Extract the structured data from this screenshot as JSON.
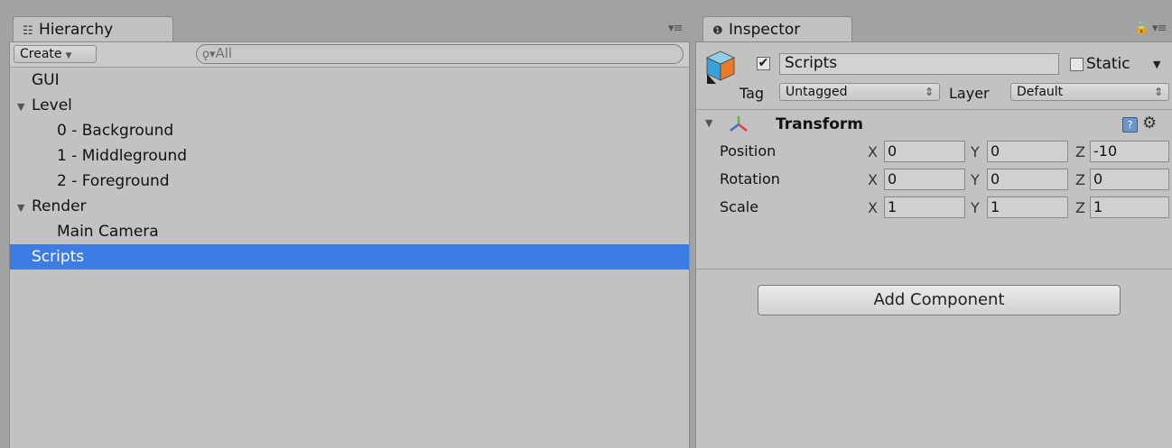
{
  "hierarchy": {
    "tab_label": "Hierarchy",
    "create_label": "Create",
    "search_placeholder": "All",
    "items": [
      {
        "label": "GUI",
        "indent": 0,
        "arrow": "",
        "selected": false
      },
      {
        "label": "Level",
        "indent": 0,
        "arrow": "▼",
        "selected": false
      },
      {
        "label": "0 - Background",
        "indent": 1,
        "arrow": "",
        "selected": false
      },
      {
        "label": "1 - Middleground",
        "indent": 1,
        "arrow": "",
        "selected": false
      },
      {
        "label": "2 - Foreground",
        "indent": 1,
        "arrow": "",
        "selected": false
      },
      {
        "label": "Render",
        "indent": 0,
        "arrow": "▼",
        "selected": false
      },
      {
        "label": "Main Camera",
        "indent": 1,
        "arrow": "",
        "selected": false
      },
      {
        "label": "Scripts",
        "indent": 0,
        "arrow": "",
        "selected": true
      }
    ]
  },
  "inspector": {
    "tab_label": "Inspector",
    "object_name": "Scripts",
    "active_checked": true,
    "static_label": "Static",
    "static_checked": false,
    "tag_label": "Tag",
    "tag_value": "Untagged",
    "layer_label": "Layer",
    "layer_value": "Default",
    "transform": {
      "title": "Transform",
      "rows": [
        {
          "label": "Position",
          "x": "0",
          "y": "0",
          "z": "-10"
        },
        {
          "label": "Rotation",
          "x": "0",
          "y": "0",
          "z": "0"
        },
        {
          "label": "Scale",
          "x": "1",
          "y": "1",
          "z": "1"
        }
      ],
      "axis_labels": {
        "x": "X",
        "y": "Y",
        "z": "Z"
      }
    },
    "add_component_label": "Add Component"
  },
  "colors": {
    "selection": "#3e7ce5",
    "panel": "#c2c2c2",
    "background": "#a2a2a2"
  }
}
